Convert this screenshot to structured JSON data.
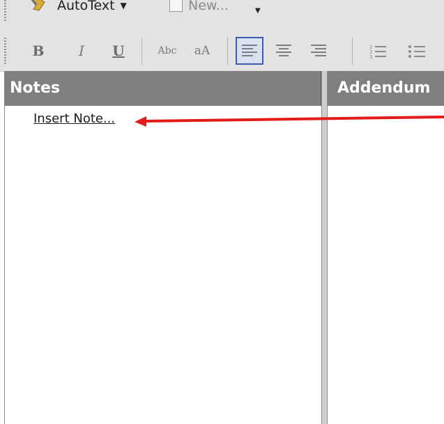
{
  "toolbar": {
    "autotext_label": "AutoText",
    "new_label": "New..."
  },
  "format_toolbar": {
    "bold": "B",
    "italic": "I",
    "underline": "U",
    "strikethrough": "Abc",
    "font_size": "aA"
  },
  "panels": {
    "notes_title": "Notes",
    "addendum_title": "Addendum",
    "insert_note_link": "Insert Note..."
  },
  "annotation": {
    "arrow_color": "#e31b1b"
  }
}
